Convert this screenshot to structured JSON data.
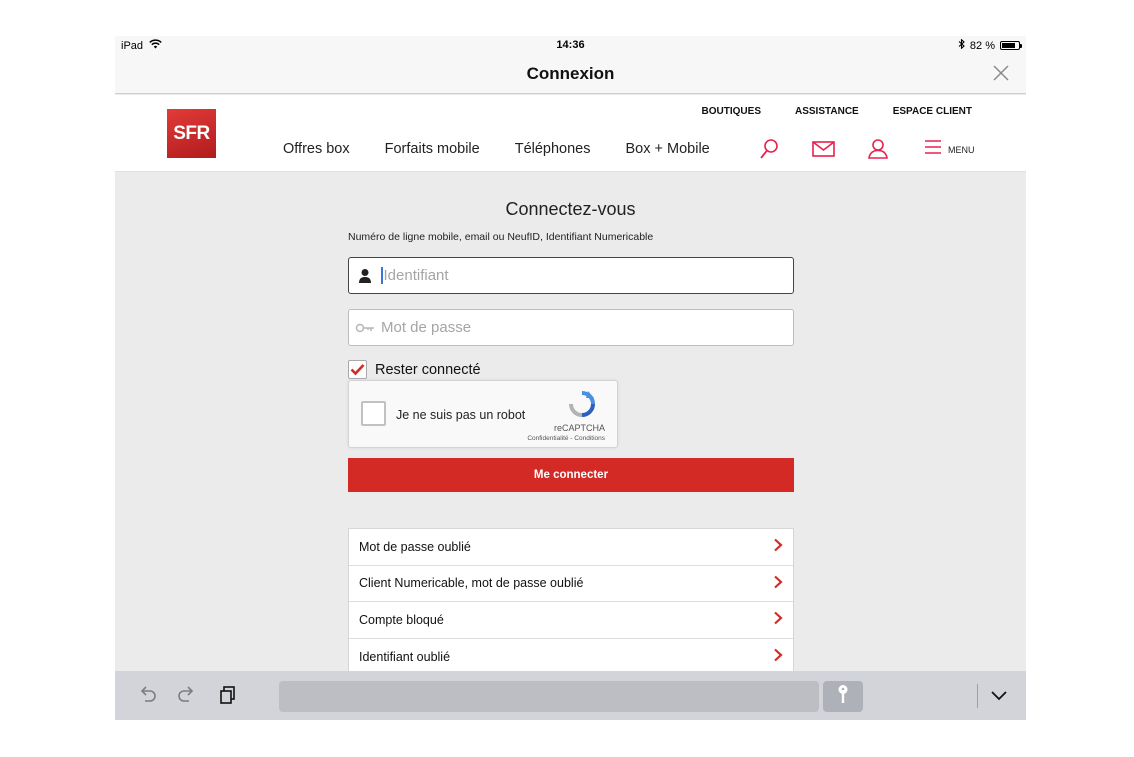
{
  "status_bar": {
    "device": "iPad",
    "time": "14:36",
    "battery_text": "82 %",
    "battery_level": 0.82
  },
  "title_bar": {
    "title": "Connexion"
  },
  "header": {
    "logo_text": "SFR",
    "top_links": [
      "BOUTIQUES",
      "ASSISTANCE",
      "ESPACE CLIENT"
    ],
    "nav": [
      "Offres box",
      "Forfaits mobile",
      "Téléphones",
      "Box + Mobile"
    ],
    "icons": [
      "search-icon",
      "mail-icon",
      "user-icon",
      "menu-icon"
    ],
    "menu_label": "MENU"
  },
  "login": {
    "heading": "Connectez-vous",
    "hint": "Numéro de ligne mobile, email ou NeufID, Identifiant Numericable",
    "identifier_placeholder": "Identifiant",
    "password_placeholder": "Mot de passe",
    "remember_label": "Rester connecté",
    "remember_checked": true,
    "recaptcha": {
      "label": "Je ne suis pas un robot",
      "brand": "reCAPTCHA",
      "legal": "Confidentialité - Conditions"
    },
    "submit_label": "Me connecter"
  },
  "help_links": [
    "Mot de passe oublié",
    "Client Numericable, mot de passe oublié",
    "Compte bloqué",
    "Identifiant oublié"
  ],
  "colors": {
    "brand_red": "#d42a26",
    "accent_pink": "#e8214e"
  }
}
